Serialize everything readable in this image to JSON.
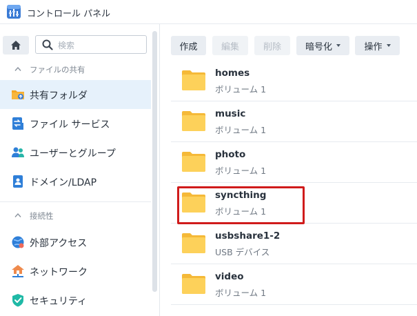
{
  "window": {
    "title": "コントロール パネル"
  },
  "sidebar": {
    "search_placeholder": "検索",
    "sections": [
      {
        "header": "ファイルの共有",
        "items": [
          {
            "label": "共有フォルダ",
            "active": true,
            "icon": "shared-folder-icon"
          },
          {
            "label": "ファイル サービス",
            "icon": "file-services-icon"
          },
          {
            "label": "ユーザーとグループ",
            "icon": "users-groups-icon"
          },
          {
            "label": "ドメイン/LDAP",
            "icon": "domain-ldap-icon"
          }
        ]
      },
      {
        "header": "接続性",
        "items": [
          {
            "label": "外部アクセス",
            "icon": "external-access-icon"
          },
          {
            "label": "ネットワーク",
            "icon": "network-icon"
          },
          {
            "label": "セキュリティ",
            "icon": "security-icon"
          }
        ]
      }
    ]
  },
  "toolbar": {
    "create": "作成",
    "edit": "編集",
    "delete": "削除",
    "encrypt": "暗号化",
    "action": "操作"
  },
  "folders": [
    {
      "name": "homes",
      "location": "ボリューム 1"
    },
    {
      "name": "music",
      "location": "ボリューム 1"
    },
    {
      "name": "photo",
      "location": "ボリューム 1"
    },
    {
      "name": "syncthing",
      "location": "ボリューム 1",
      "highlighted": true
    },
    {
      "name": "usbshare1-2",
      "location": "USB デバイス"
    },
    {
      "name": "video",
      "location": "ボリューム 1"
    }
  ],
  "colors": {
    "active_item_bg": "#e6f1fb",
    "folder_yellow": "#f8c94c",
    "highlight_red": "#d01b1b"
  }
}
